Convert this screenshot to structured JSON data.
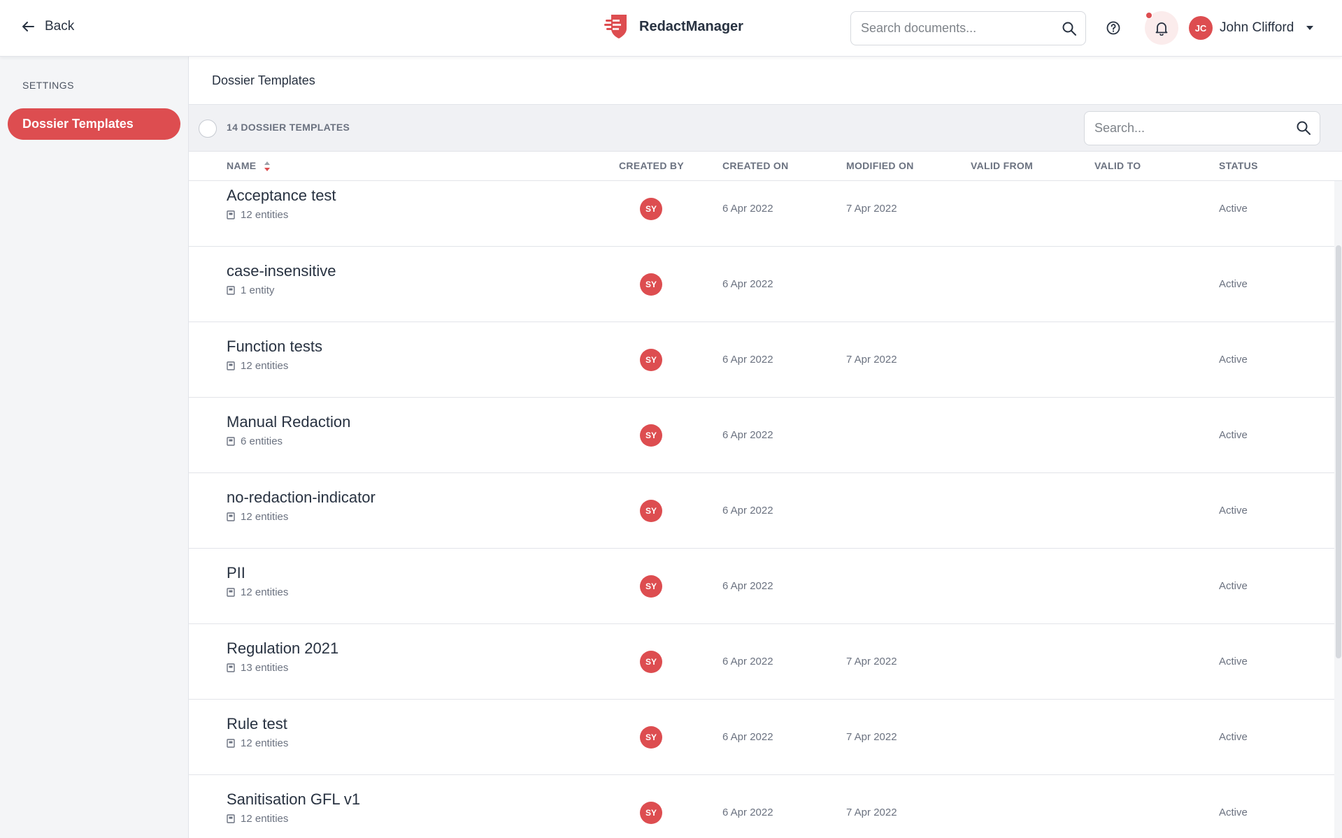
{
  "header": {
    "back_label": "Back",
    "brand_name": "RedactManager",
    "search_placeholder": "Search documents...",
    "user_initials": "JC",
    "user_name": "John Clifford"
  },
  "sidebar": {
    "section_title": "SETTINGS",
    "items": [
      {
        "label": "Dossier Templates",
        "active": true
      }
    ]
  },
  "main": {
    "page_title": "Dossier Templates",
    "count_label": "14 DOSSIER TEMPLATES",
    "search_placeholder": "Search...",
    "columns": {
      "name": "NAME",
      "created_by": "CREATED BY",
      "created_on": "CREATED ON",
      "modified_on": "MODIFIED ON",
      "valid_from": "VALID FROM",
      "valid_to": "VALID TO",
      "status": "STATUS"
    },
    "rows": [
      {
        "name": "Acceptance test",
        "entities": "12 entities",
        "created_by": "SY",
        "created_on": "6 Apr 2022",
        "modified_on": "7 Apr 2022",
        "valid_from": "",
        "valid_to": "",
        "status": "Active"
      },
      {
        "name": "case-insensitive",
        "entities": "1 entity",
        "created_by": "SY",
        "created_on": "6 Apr 2022",
        "modified_on": "",
        "valid_from": "",
        "valid_to": "",
        "status": "Active"
      },
      {
        "name": "Function tests",
        "entities": "12 entities",
        "created_by": "SY",
        "created_on": "6 Apr 2022",
        "modified_on": "7 Apr 2022",
        "valid_from": "",
        "valid_to": "",
        "status": "Active"
      },
      {
        "name": "Manual Redaction",
        "entities": "6 entities",
        "created_by": "SY",
        "created_on": "6 Apr 2022",
        "modified_on": "",
        "valid_from": "",
        "valid_to": "",
        "status": "Active"
      },
      {
        "name": "no-redaction-indicator",
        "entities": "12 entities",
        "created_by": "SY",
        "created_on": "6 Apr 2022",
        "modified_on": "",
        "valid_from": "",
        "valid_to": "",
        "status": "Active"
      },
      {
        "name": "PII",
        "entities": "12 entities",
        "created_by": "SY",
        "created_on": "6 Apr 2022",
        "modified_on": "",
        "valid_from": "",
        "valid_to": "",
        "status": "Active"
      },
      {
        "name": "Regulation 2021",
        "entities": "13 entities",
        "created_by": "SY",
        "created_on": "6 Apr 2022",
        "modified_on": "7 Apr 2022",
        "valid_from": "",
        "valid_to": "",
        "status": "Active"
      },
      {
        "name": "Rule test",
        "entities": "12 entities",
        "created_by": "SY",
        "created_on": "6 Apr 2022",
        "modified_on": "7 Apr 2022",
        "valid_from": "",
        "valid_to": "",
        "status": "Active"
      },
      {
        "name": "Sanitisation GFL v1",
        "entities": "12 entities",
        "created_by": "SY",
        "created_on": "6 Apr 2022",
        "modified_on": "7 Apr 2022",
        "valid_from": "",
        "valid_to": "",
        "status": "Active"
      }
    ]
  },
  "colors": {
    "accent": "#dd4d50",
    "text": "#283241",
    "muted": "#6b7280",
    "toolbar_bg": "#f0f1f4",
    "sidebar_bg": "#f4f5f7"
  },
  "icons": [
    "arrow-left-icon",
    "redact-logo-icon",
    "search-icon",
    "help-icon",
    "bell-icon",
    "chevron-down-icon",
    "sort-icon",
    "entity-icon"
  ]
}
